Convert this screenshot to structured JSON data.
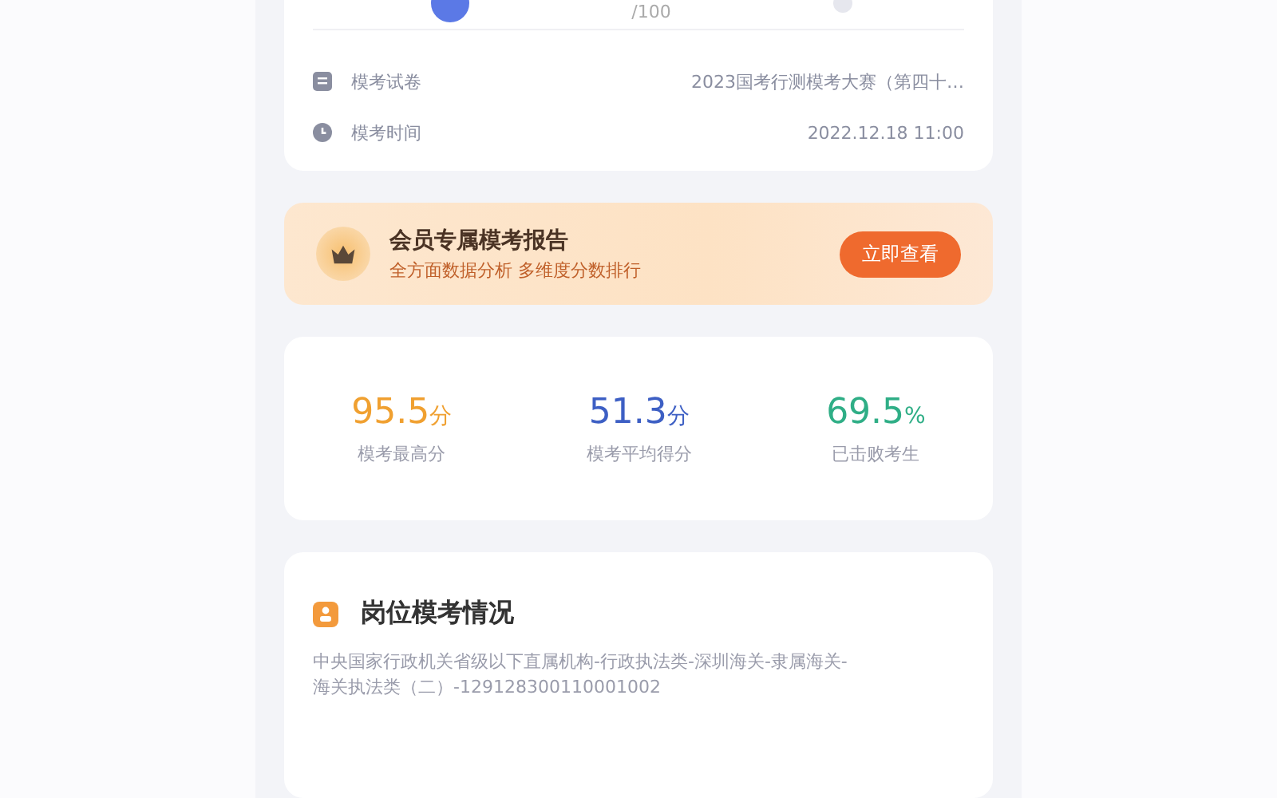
{
  "score_card": {
    "total": "/100",
    "rows": [
      {
        "kind": "paper",
        "label": "模考试卷",
        "value": "2023国考行测模考大赛（第四十…"
      },
      {
        "kind": "time",
        "label": "模考时间",
        "value": "2022.12.18 11:00"
      }
    ]
  },
  "member_banner": {
    "title": "会员专属模考报告",
    "subtitle": "全方面数据分析 多维度分数排行",
    "button": "立即查看"
  },
  "stats": [
    {
      "value": "95.5",
      "unit": "分",
      "label": "模考最高分",
      "color": "#f0a030"
    },
    {
      "value": "51.3",
      "unit": "分",
      "label": "模考平均得分",
      "color": "#3d5fc4"
    },
    {
      "value": "69.5",
      "unit": "%",
      "label": "已击败考生",
      "color": "#2fae86"
    }
  ],
  "position_card": {
    "title": "岗位模考情况",
    "description": "中央国家行政机关省级以下直属机构-行政执法类-深圳海关-隶属海关-海关执法类（二）-129128300110001002"
  }
}
